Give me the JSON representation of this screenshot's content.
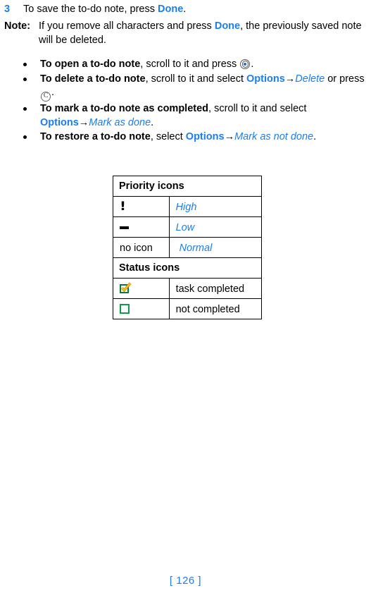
{
  "page": {
    "footer": "[ 126 ]",
    "accent_blue": "#1a7ef0",
    "icon_green_dark": "#0a7a3c",
    "icon_green": "#0a9d4a",
    "check_yellow": "#f5b300"
  },
  "step": {
    "number": "3",
    "text_1": "To save the to-do note, press ",
    "emph_1": "Done",
    "text_2": "."
  },
  "note": {
    "label": "Note:",
    "text_1": "If you remove all characters and press ",
    "emph_1": "Done",
    "text_2": ", the previously saved note will be deleted."
  },
  "bullets": [
    {
      "lead": "To open a to-do note",
      "text_1": ", scroll to it and press ",
      "icon_1": "select-key-icon",
      "text_2": "."
    },
    {
      "lead": "To delete a to-do note",
      "text_1": ", scroll to it and select ",
      "menu_1": "Options",
      "arrow_1": "→",
      "item_1": "Delete",
      "text_2": " or press ",
      "icon_1": "clear-key-icon",
      "icon_1_label": "C",
      "text_3": "."
    },
    {
      "lead": "To mark a to-do note as completed",
      "text_1": ", scroll to it and select ",
      "menu_1": "Options",
      "arrow_1": "→",
      "item_1": "Mark as done",
      "text_2": "."
    },
    {
      "lead": "To restore a to-do note",
      "text_1": ", select ",
      "menu_1": "Options",
      "arrow_1": "→",
      "item_1": "Mark as not done",
      "text_2": "."
    }
  ],
  "table": {
    "header_priority": "Priority icons",
    "header_status": "Status icons",
    "priority_rows": [
      {
        "icon": "exclamation-icon",
        "glyph": "!",
        "label": "High"
      },
      {
        "icon": "dash-icon",
        "glyph": "—",
        "label": "Low"
      },
      {
        "icon": "no-icon-text",
        "glyph": "no icon",
        "label": "Normal"
      }
    ],
    "status_rows": [
      {
        "icon": "checked-box-icon",
        "label": "task completed"
      },
      {
        "icon": "empty-box-icon",
        "label": "not completed"
      }
    ]
  }
}
